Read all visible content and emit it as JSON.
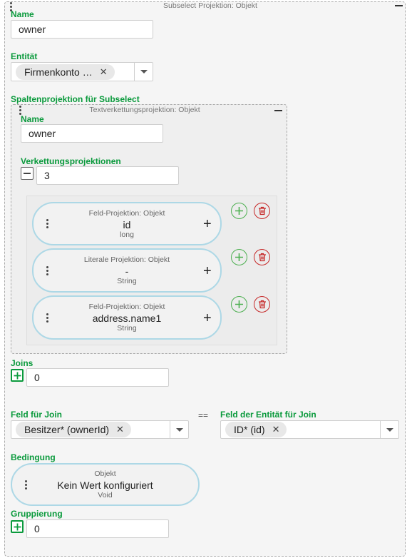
{
  "outer": {
    "title": "Subselect Projektion: Objekt",
    "name_label": "Name",
    "name_value": "owner",
    "entity_label": "Entität",
    "entity_chip": "Firmenkonto …",
    "columns_label": "Spaltenprojektion für Subselect",
    "joins_label": "Joins",
    "joins_value": "0",
    "join_field_label": "Feld für Join",
    "join_field_chip": "Besitzer* (ownerId)",
    "equals": "==",
    "entity_join_field_label": "Feld der Entität für Join",
    "entity_join_field_chip": "ID* (id)",
    "condition_label": "Bedingung",
    "condition": {
      "type": "Objekt",
      "value": "Kein Wert konfiguriert",
      "datatype": "Void"
    },
    "grouping_label": "Gruppierung",
    "grouping_value": "0"
  },
  "inner": {
    "title": "Textverkettungsprojektion: Objekt",
    "name_label": "Name",
    "name_value": "owner",
    "chain_label": "Verkettungsprojektionen",
    "chain_value": "3",
    "items": [
      {
        "type": "Feld-Projektion: Objekt",
        "value": "id",
        "datatype": "long"
      },
      {
        "type": "Literale Projektion: Objekt",
        "value": "-",
        "datatype": "String"
      },
      {
        "type": "Feld-Projektion: Objekt",
        "value": "address.name1",
        "datatype": "String"
      }
    ]
  },
  "colors": {
    "label_green": "#0a9a3c",
    "add_green": "#4caf50",
    "delete_red": "#c62828",
    "pill_border": "#add8e6"
  },
  "icons": {
    "add": "plus-circle-icon",
    "delete": "trash-icon",
    "collapse": "minus-icon",
    "drag": "vertical-dots-icon",
    "expand": "plus-icon",
    "remove_chip": "close-icon",
    "dropdown": "chevron-down-icon"
  }
}
